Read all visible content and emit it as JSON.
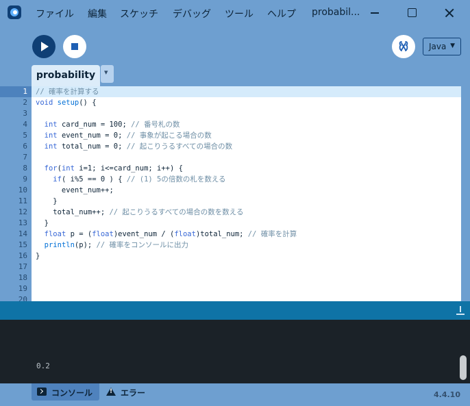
{
  "menu": {
    "items": [
      "ファイル",
      "編集",
      "スケッチ",
      "デバッグ",
      "ツール",
      "ヘルプ"
    ],
    "window_title": "probabil..."
  },
  "toolbar": {
    "run": "run-icon",
    "stop": "stop-icon",
    "debug": "debug-icon",
    "mode": "Java"
  },
  "tab": {
    "name": "probability"
  },
  "editor": {
    "line_numbers": [
      "1",
      "2",
      "3",
      "4",
      "5",
      "6",
      "7",
      "8",
      "9",
      "10",
      "11",
      "12",
      "13",
      "14",
      "15",
      "16",
      "17",
      "18",
      "19",
      "20"
    ],
    "current_line": "1",
    "lines": [
      "// 確率を計算する",
      "void setup() {",
      "",
      "  int card_num = 100; // 番号札の数",
      "  int event_num = 0; // 事象が起こる場合の数",
      "  int total_num = 0; // 起こりうるすべての場合の数",
      "",
      "  for(int i=1; i<=card_num; i++) {",
      "    if( i%5 == 0 ) { // (1) 5の倍数の札を数える",
      "      event_num++;",
      "    }",
      "    total_num++; // 起こりうるすべての場合の数を数える",
      "  }",
      "  float p = (float)event_num / (float)total_num; // 確率を計算",
      "  println(p); // 確率をコンソールに出力",
      "}"
    ]
  },
  "console": {
    "output": "0.2"
  },
  "footer": {
    "console_tab": "コンソール",
    "errors_tab": "エラー",
    "version": "4.4.10"
  },
  "colors": {
    "chrome": "#6e9fd0",
    "run_button": "#0f3f75",
    "console_bg": "#1b2228",
    "divider": "#0f73a6",
    "keyword": "#3767d6",
    "comment": "#6f8fa6"
  }
}
